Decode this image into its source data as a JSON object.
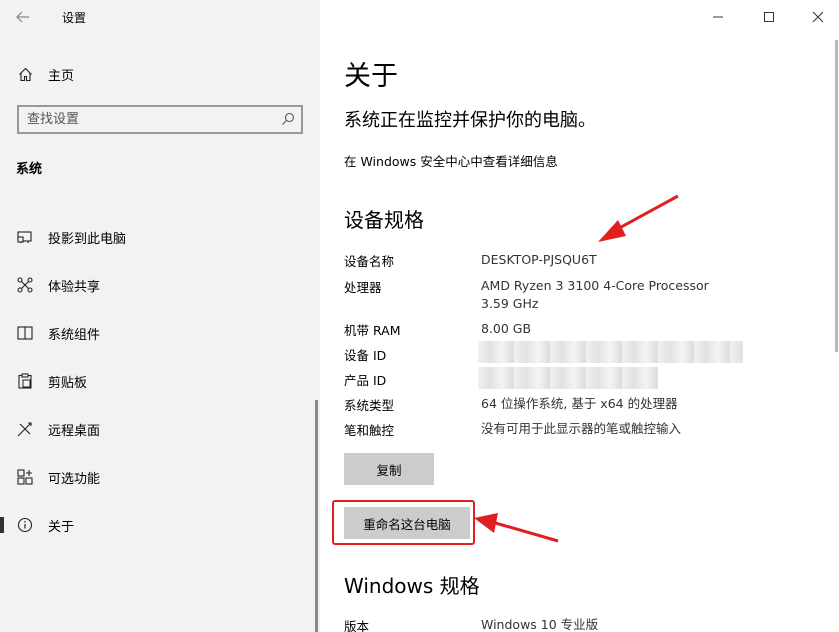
{
  "window": {
    "app_title": "设置"
  },
  "sidebar": {
    "home_label": "主页",
    "search_placeholder": "查找设置",
    "section_label": "系统",
    "items": [
      {
        "label": "投影到此电脑",
        "icon": "projector-icon"
      },
      {
        "label": "体验共享",
        "icon": "share-experience-icon"
      },
      {
        "label": "系统组件",
        "icon": "system-components-icon"
      },
      {
        "label": "剪贴板",
        "icon": "clipboard-icon"
      },
      {
        "label": "远程桌面",
        "icon": "remote-desktop-icon"
      },
      {
        "label": "可选功能",
        "icon": "optional-features-icon"
      },
      {
        "label": "关于",
        "icon": "info-icon",
        "active": true
      }
    ]
  },
  "main": {
    "title": "关于",
    "protection_status": "系统正在监控并保护你的电脑。",
    "security_link": "在 Windows 安全中心中查看详细信息",
    "device_specs": {
      "heading": "设备规格",
      "rows": [
        {
          "key": "设备名称",
          "value": "DESKTOP-PJSQU6T"
        },
        {
          "key": "处理器",
          "value": "AMD Ryzen 3 3100 4-Core Processor",
          "value2": "3.59 GHz"
        },
        {
          "key": "机带 RAM",
          "value": "8.00 GB"
        },
        {
          "key": "设备 ID",
          "value": ""
        },
        {
          "key": "产品 ID",
          "value": ""
        },
        {
          "key": "系统类型",
          "value": "64 位操作系统, 基于 x64 的处理器"
        },
        {
          "key": "笔和触控",
          "value": "没有可用于此显示器的笔或触控输入"
        }
      ],
      "copy_button": "复制",
      "rename_button": "重命名这台电脑"
    },
    "windows_specs": {
      "heading": "Windows 规格",
      "rows": [
        {
          "key": "版本",
          "value": "Windows 10 专业版"
        }
      ]
    }
  },
  "colors": {
    "sidebar_bg": "#f2f2f2",
    "button_bg": "#cccccc",
    "annotation_red": "#e02020"
  }
}
